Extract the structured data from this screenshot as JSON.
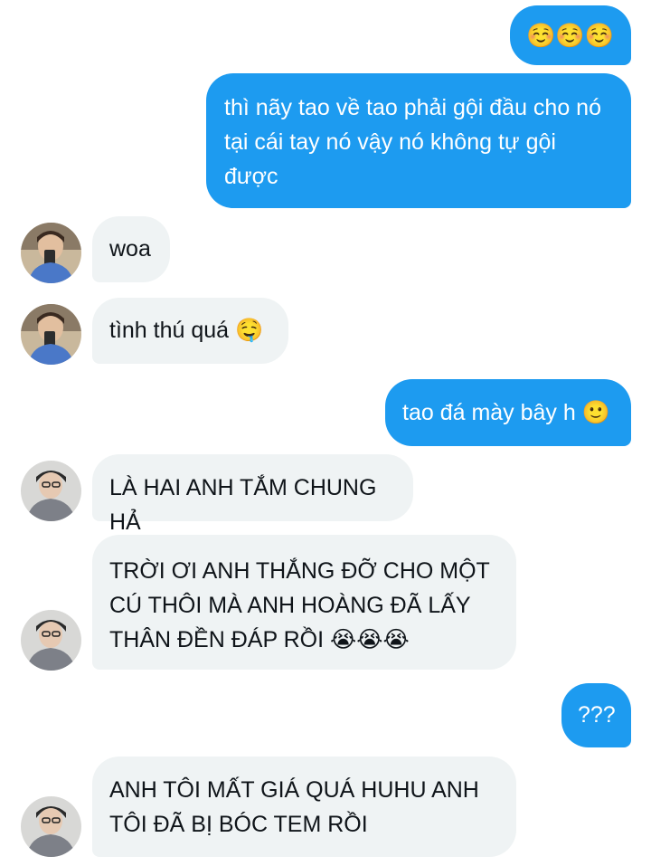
{
  "messages": [
    {
      "side": "out",
      "text": "☺️☺️☺️"
    },
    {
      "side": "out",
      "text": "thì nãy tao về tao phải gội đầu cho nó tại cái tay nó vậy nó không tự gội được"
    },
    {
      "side": "in",
      "sender": "friend-1",
      "text": "woa"
    },
    {
      "side": "in",
      "sender": "friend-1",
      "text": "tình thú quá 🤤"
    },
    {
      "side": "out",
      "text": "tao đá mày bây h 🙂"
    },
    {
      "side": "in",
      "sender": "friend-2",
      "text": "LÀ HAI ANH TẮM CHUNG HẢ"
    },
    {
      "side": "in",
      "sender": "friend-2",
      "text": "TRỜI ƠI ANH THẮNG ĐỠ CHO MỘT CÚ THÔI MÀ ANH HOÀNG ĐÃ LẤY THÂN ĐỀN ĐÁP RỒI 😭😭😭"
    },
    {
      "side": "out",
      "text": "???"
    },
    {
      "side": "in",
      "sender": "friend-2",
      "text": "ANH TÔI MẤT GIÁ QUÁ HUHU ANH TÔI ĐÃ BỊ BÓC TEM RỒI"
    }
  ],
  "colors": {
    "outgoing_bubble": "#1d9bf0",
    "incoming_bubble": "#eff3f4",
    "outgoing_text": "#ffffff",
    "incoming_text": "#0f1419"
  }
}
